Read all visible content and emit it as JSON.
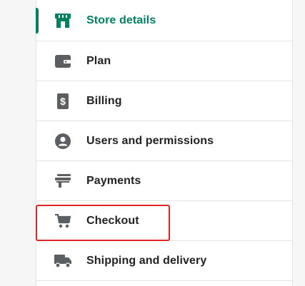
{
  "settings_nav": {
    "items": [
      {
        "id": "store-details",
        "label": "Store details",
        "icon": "store-icon",
        "active": true
      },
      {
        "id": "plan",
        "label": "Plan",
        "icon": "wallet-icon",
        "active": false
      },
      {
        "id": "billing",
        "label": "Billing",
        "icon": "bill-dollar-icon",
        "active": false
      },
      {
        "id": "users",
        "label": "Users and permissions",
        "icon": "user-circle-icon",
        "active": false
      },
      {
        "id": "payments",
        "label": "Payments",
        "icon": "payment-card-icon",
        "active": false
      },
      {
        "id": "checkout",
        "label": "Checkout",
        "icon": "cart-icon",
        "active": false,
        "highlighted": true
      },
      {
        "id": "shipping",
        "label": "Shipping and delivery",
        "icon": "truck-icon",
        "active": false
      }
    ]
  },
  "colors": {
    "active": "#008060",
    "text": "#202223",
    "icon": "#5c5f62",
    "highlight": "#e02424"
  }
}
